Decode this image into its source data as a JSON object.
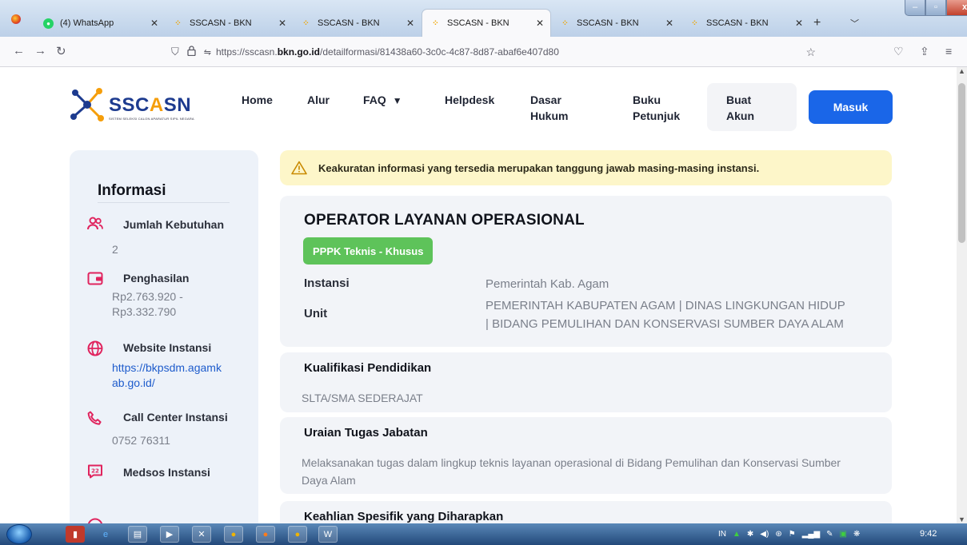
{
  "browser": {
    "tabs": [
      {
        "title": "(4) WhatsApp",
        "icon": "whatsapp-icon",
        "active": false
      },
      {
        "title": "SSCASN - BKN",
        "icon": "sscasn-icon",
        "active": false
      },
      {
        "title": "SSCASN - BKN",
        "icon": "sscasn-icon",
        "active": false
      },
      {
        "title": "SSCASN - BKN",
        "icon": "sscasn-icon",
        "active": true
      },
      {
        "title": "SSCASN - BKN",
        "icon": "sscasn-icon",
        "active": false
      },
      {
        "title": "SSCASN - BKN",
        "icon": "sscasn-icon",
        "active": false
      }
    ],
    "url_prefix": "https://sscasn.",
    "url_domain": "bkn.go.id",
    "url_path": "/detailformasi/81438a60-3c0c-4c87-8d87-abaf6e407d80"
  },
  "site": {
    "logo_text_main": "SSC",
    "logo_text_accent": "A",
    "logo_text_end": "SN",
    "logo_tagline": "SISTEM SELEKSI CALON APARATUR SIPIL NEGARA",
    "menu": {
      "home": "Home",
      "alur": "Alur",
      "faq": "FAQ",
      "helpdesk": "Helpdesk",
      "dasar_1": "Dasar",
      "dasar_2": "Hukum",
      "buku_1": "Buku",
      "buku_2": "Petunjuk",
      "buat_1": "Buat",
      "buat_2": "Akun",
      "masuk": "Masuk"
    }
  },
  "sidebar": {
    "title": "Informasi",
    "jumlah_label": "Jumlah Kebutuhan",
    "jumlah_value": "2",
    "penghasilan_label": "Penghasilan",
    "penghasilan_line1": "Rp2.763.920 -",
    "penghasilan_line2": "Rp3.332.790",
    "website_label": "Website Instansi",
    "website_line1": "https://bkpsdm.agamk",
    "website_line2": "ab.go.id/",
    "callcenter_label": "Call Center Instansi",
    "callcenter_value": "0752 76311",
    "medsos_label": "Medsos Instansi"
  },
  "main": {
    "alert_text": "Keakuratan informasi yang tersedia merupakan tanggung jawab masing-masing instansi.",
    "job_title": "OPERATOR LAYANAN OPERASIONAL",
    "badge": "PPPK Teknis - Khusus",
    "instansi_label": "Instansi",
    "instansi_value": "Pemerintah Kab. Agam",
    "unit_label": "Unit",
    "unit_line1": "PEMERINTAH KABUPATEN AGAM | DINAS LINGKUNGAN HIDUP",
    "unit_line2": "| BIDANG PEMULIHAN DAN KONSERVASI SUMBER DAYA ALAM",
    "kualifikasi_head": "Kualifikasi Pendidikan",
    "kualifikasi_value": "SLTA/SMA SEDERAJAT",
    "uraian_head": "Uraian Tugas Jabatan",
    "uraian_line1": "Melaksanakan tugas dalam lingkup teknis layanan operasional di Bidang Pemulihan dan Konservasi Sumber",
    "uraian_line2": "Daya Alam",
    "keahlian_head": "Keahlian Spesifik yang Diharapkan"
  },
  "taskbar": {
    "lang": "IN",
    "clock": "9:42"
  },
  "colors": {
    "primary": "#1a66e8",
    "badge_green": "#5ec35a",
    "alert_bg": "#fdf6c9",
    "sidebar_bg": "#edf2f9",
    "icon_pink": "#e0245e"
  }
}
